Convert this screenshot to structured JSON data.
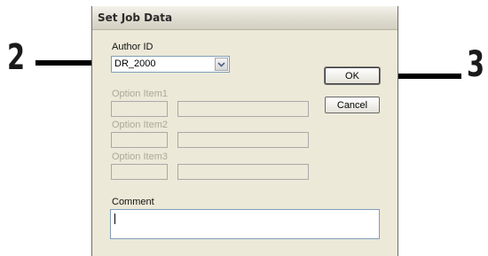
{
  "callouts": {
    "left_step": "2",
    "right_step": "3"
  },
  "dialog": {
    "title": "Set Job Data",
    "author": {
      "label": "Author ID",
      "value": "DR_2000"
    },
    "option_items": [
      {
        "label": "Option Item1",
        "value": "",
        "text": ""
      },
      {
        "label": "Option Item2",
        "value": "",
        "text": ""
      },
      {
        "label": "Option Item3",
        "value": "",
        "text": ""
      }
    ],
    "comment": {
      "label": "Comment",
      "value": ""
    },
    "buttons": {
      "ok": "OK",
      "cancel": "Cancel"
    }
  },
  "colors": {
    "dialog_bg": "#ece9d8",
    "disabled_text": "#aca899",
    "field_border": "#7f9db9"
  }
}
